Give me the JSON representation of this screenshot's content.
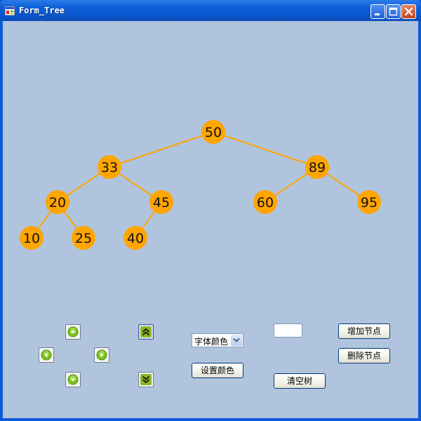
{
  "window": {
    "title": "Form_Tree",
    "background": "#b0c4de",
    "controls": [
      "minimize-icon",
      "maximize-icon",
      "close-icon"
    ]
  },
  "tree": {
    "node_color": "#ffa500",
    "edge_color": "#ffa500",
    "nodes": [
      {
        "id": "n50",
        "value": "50"
      },
      {
        "id": "n33",
        "value": "33"
      },
      {
        "id": "n89",
        "value": "89"
      },
      {
        "id": "n20",
        "value": "20"
      },
      {
        "id": "n45",
        "value": "45"
      },
      {
        "id": "n60",
        "value": "60"
      },
      {
        "id": "n95",
        "value": "95"
      },
      {
        "id": "n10",
        "value": "10"
      },
      {
        "id": "n25",
        "value": "25"
      },
      {
        "id": "n40",
        "value": "40"
      }
    ],
    "edges": [
      [
        "n50",
        "n33"
      ],
      [
        "n50",
        "n89"
      ],
      [
        "n33",
        "n20"
      ],
      [
        "n33",
        "n45"
      ],
      [
        "n89",
        "n60"
      ],
      [
        "n89",
        "n95"
      ],
      [
        "n20",
        "n10"
      ],
      [
        "n20",
        "n25"
      ],
      [
        "n45",
        "n40"
      ]
    ]
  },
  "controls": {
    "move_buttons": [
      "arrow-up-icon",
      "arrow-left-icon",
      "arrow-right-icon",
      "arrow-down-icon"
    ],
    "scale_buttons": [
      "double-chevron-up-icon",
      "double-chevron-down-icon"
    ],
    "font_color_select": "字体颜色",
    "set_color_button": "设置颜色",
    "node_value_input": "",
    "add_node_button": "增加节点",
    "delete_node_button": "删除节点",
    "clear_tree_button": "清空树"
  }
}
